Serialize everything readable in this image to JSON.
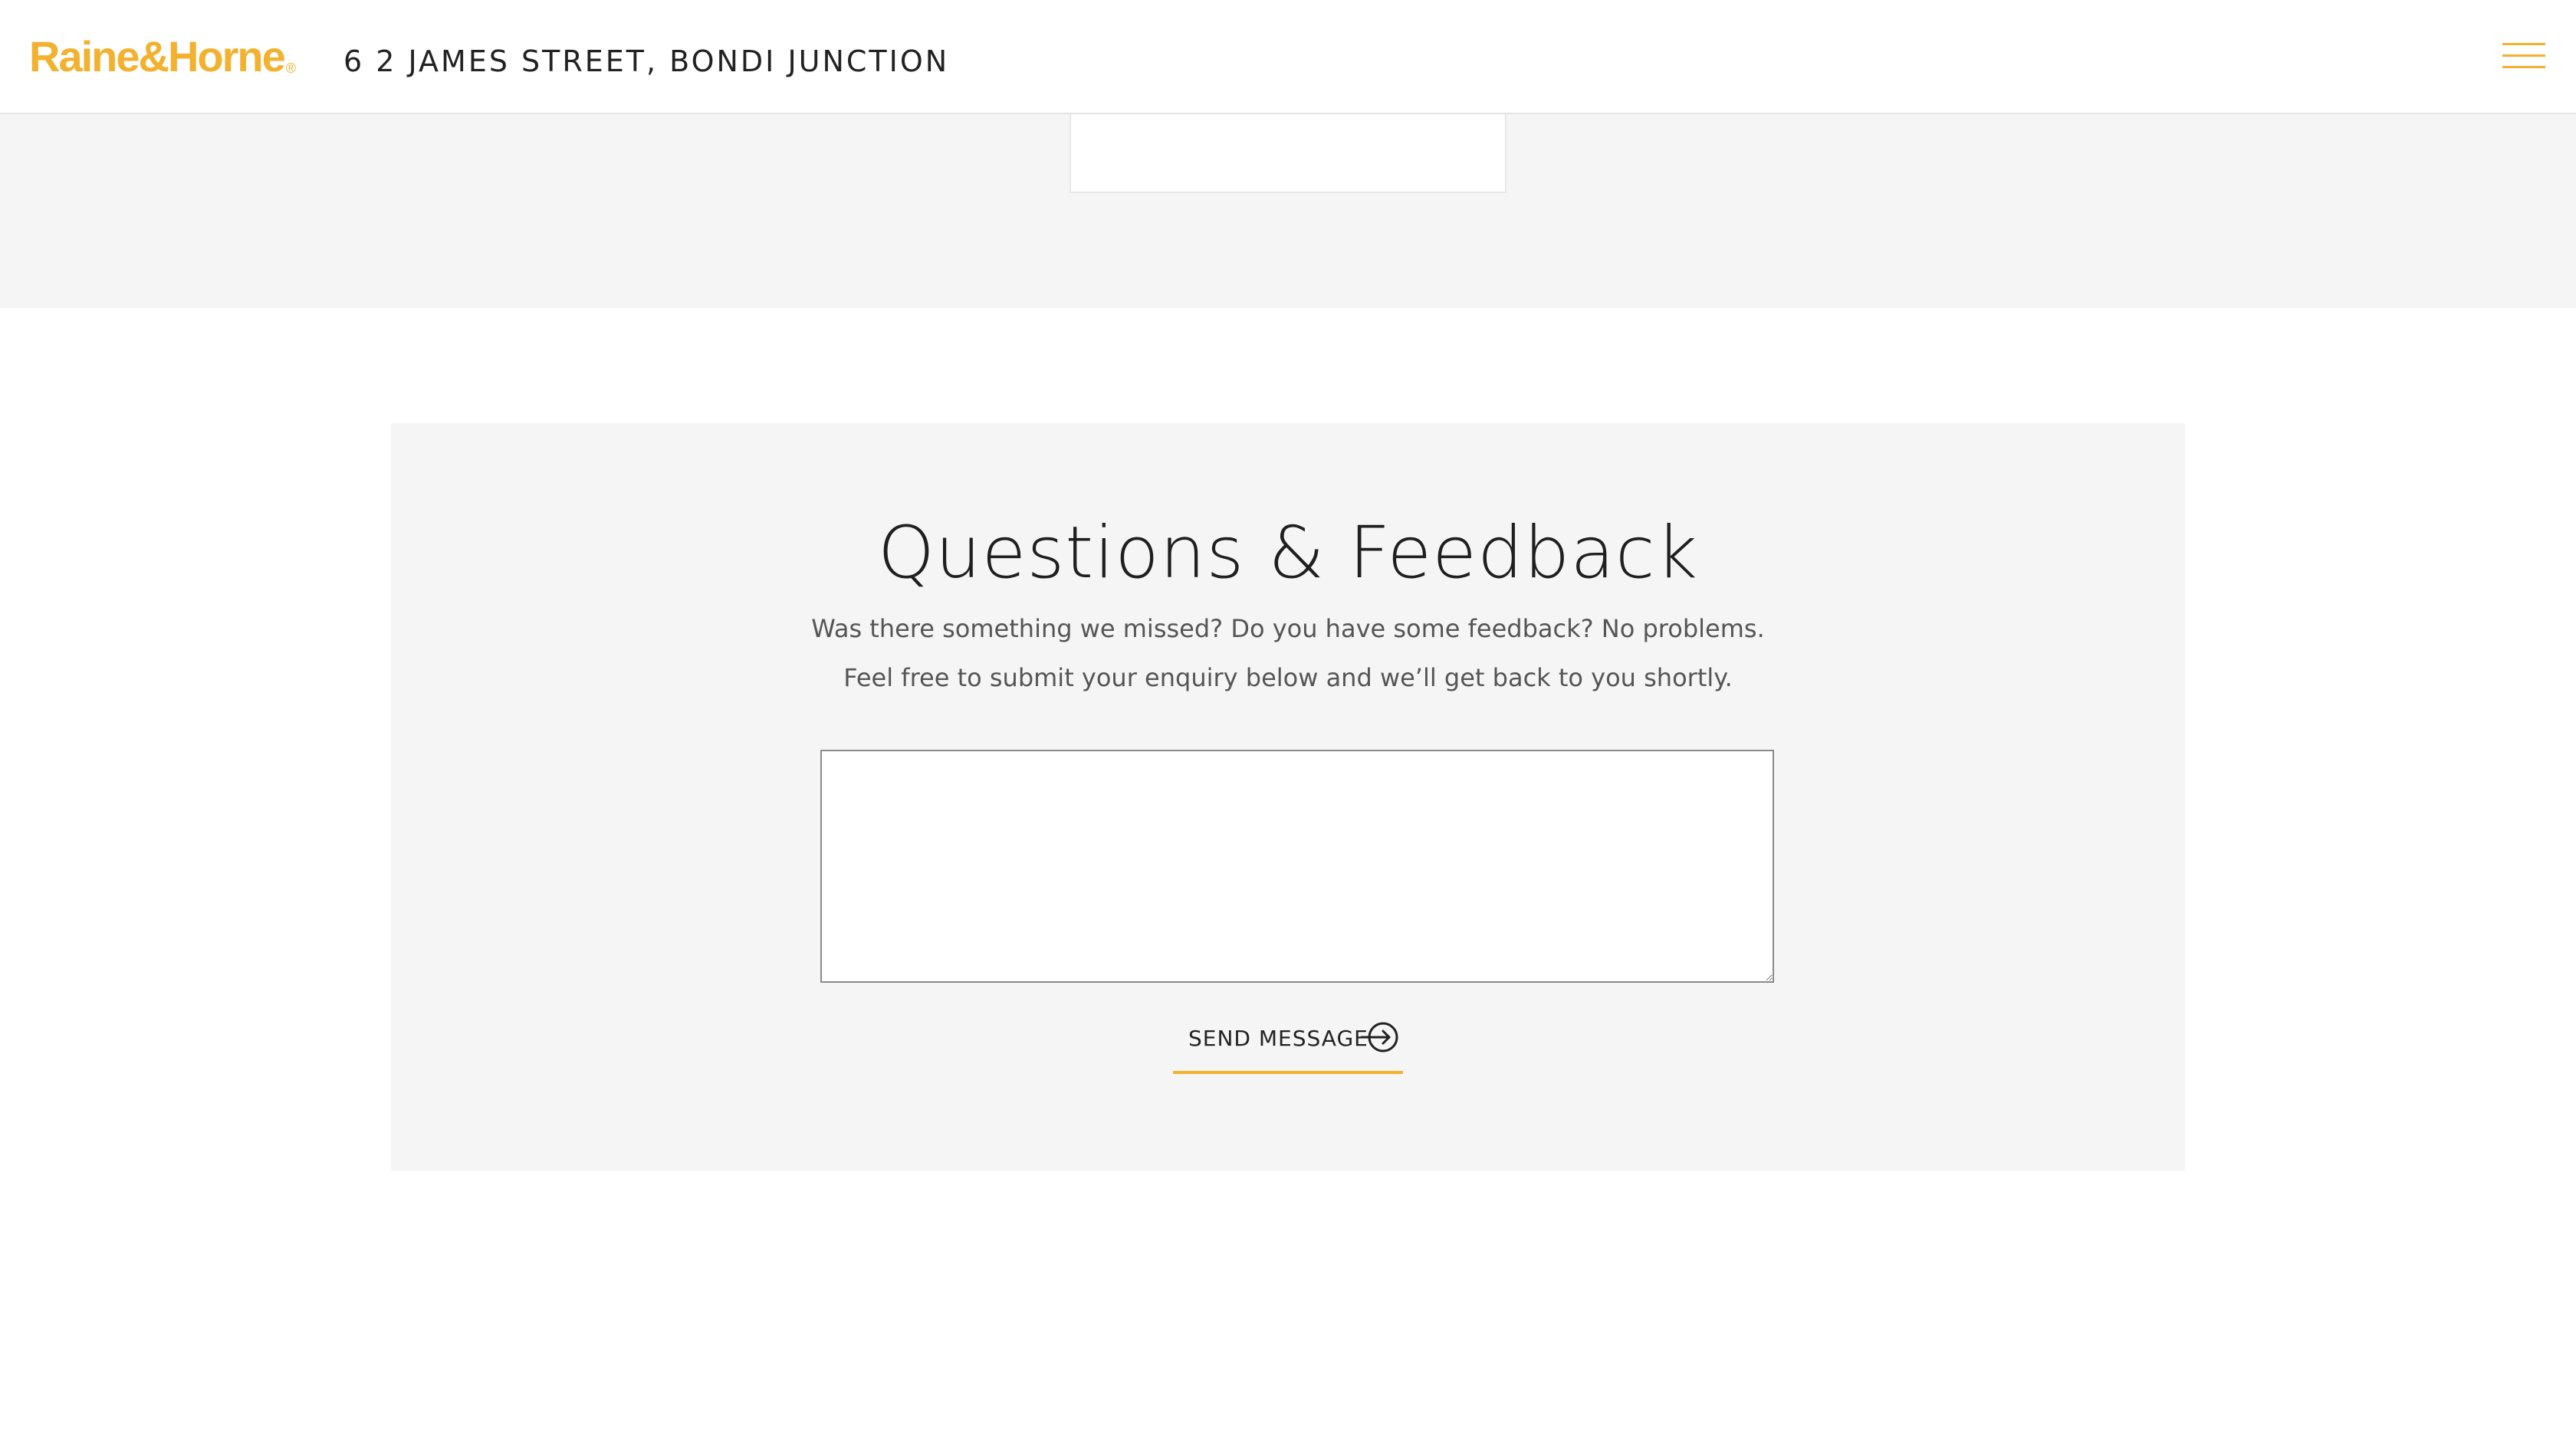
{
  "header": {
    "logo_text": "Raine&Horne",
    "logo_registered": "®",
    "address": "6 2 JAMES STREET, BONDI JUNCTION",
    "menu_icon": "hamburger-menu-icon"
  },
  "feedback": {
    "title": "Questions & Feedback",
    "line1": "Was there something we missed? Do you have some feedback? No problems.",
    "line2": "Feel free to submit your enquiry below and we’ll get back to you shortly.",
    "message_value": "",
    "send_label": "SEND MESSAGE",
    "send_icon": "arrow-circle-right-icon"
  },
  "colors": {
    "brand": "#F2B12E",
    "panel_bg": "#f5f5f5",
    "text": "#222222"
  }
}
